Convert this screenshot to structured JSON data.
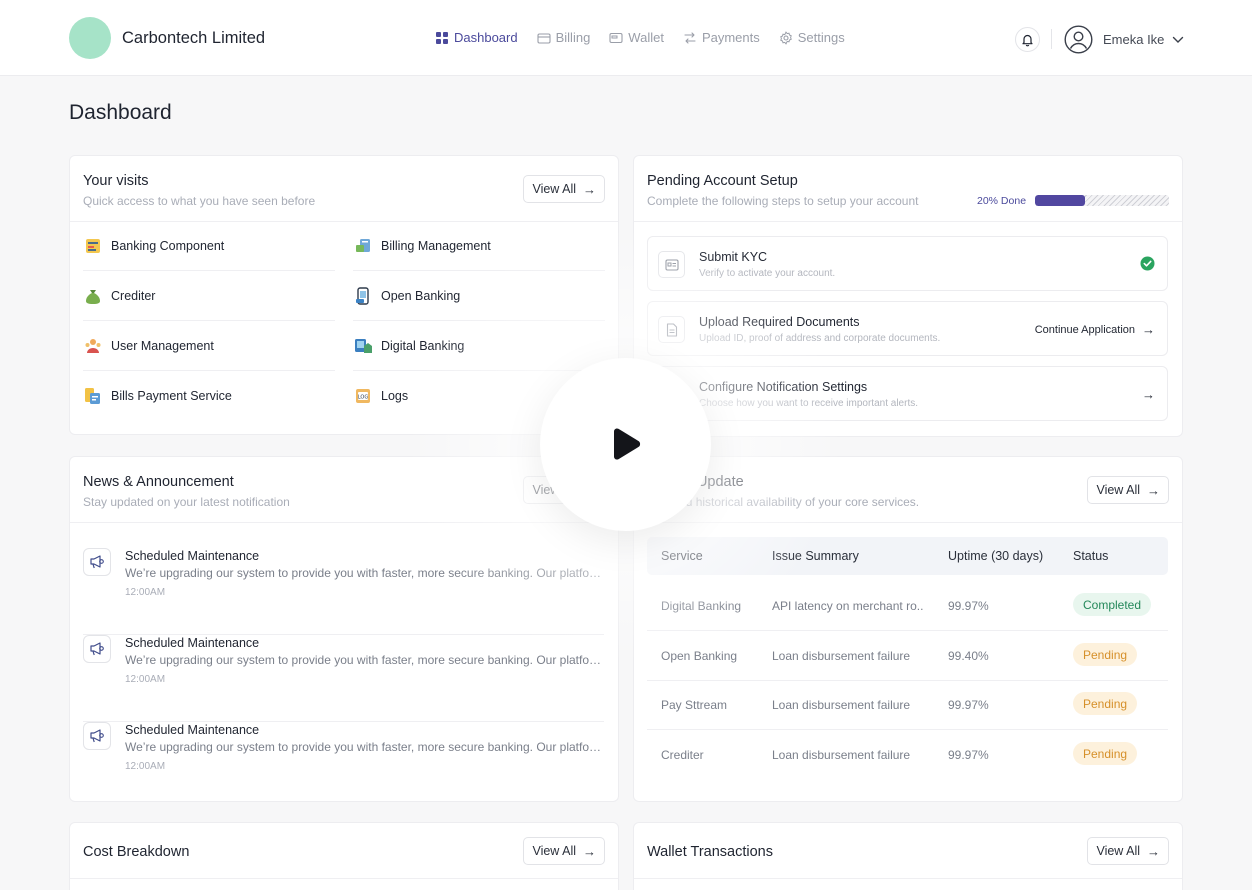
{
  "header": {
    "company": "Carbontech Limited",
    "nav": [
      {
        "label": "Dashboard",
        "icon": "grid-icon",
        "active": true
      },
      {
        "label": "Billing",
        "icon": "card-icon",
        "active": false
      },
      {
        "label": "Wallet",
        "icon": "wallet-icon",
        "active": false
      },
      {
        "label": "Payments",
        "icon": "transfer-icon",
        "active": false
      },
      {
        "label": "Settings",
        "icon": "gear-icon",
        "active": false
      }
    ],
    "user_name": "Emeka Ike"
  },
  "page": {
    "title": "Dashboard"
  },
  "visits": {
    "title": "Your visits",
    "subtitle": "Quick access to what you have seen before",
    "view_all": "View All",
    "items": [
      {
        "label": "Banking Component"
      },
      {
        "label": "Billing Management"
      },
      {
        "label": "Crediter"
      },
      {
        "label": "Open Banking"
      },
      {
        "label": "User Management"
      },
      {
        "label": "Digital Banking"
      },
      {
        "label": "Bills Payment Service"
      },
      {
        "label": "Logs"
      }
    ]
  },
  "setup": {
    "title": "Pending Account Setup",
    "subtitle": "Complete the following steps to setup your account",
    "progress_label": "20% Done",
    "progress_value": 0.37,
    "steps": [
      {
        "title": "Submit KYC",
        "desc": "Verify to activate your account.",
        "action": ""
      },
      {
        "title": "Upload Required Documents",
        "desc": "Upload ID, proof of address and corporate documents.",
        "action": "Continue Application"
      },
      {
        "title": "Configure Notification Settings",
        "desc": "Choose how you want to receive important alerts.",
        "action": ""
      }
    ]
  },
  "news": {
    "title": "News & Announcement",
    "subtitle": "Stay updated on your latest notification",
    "view_all": "View All",
    "items": [
      {
        "title": "Scheduled Maintenance",
        "body": "We’re upgrading our system to provide you with faster, more secure banking. Our platform will be briefly unavailable during the scheduled window.",
        "time": "12:00AM"
      },
      {
        "title": "Scheduled Maintenance",
        "body": "We’re upgrading our system to provide you with faster, more secure banking. Our platform will be briefly unavailable during the scheduled window.",
        "time": "12:00AM"
      },
      {
        "title": "Scheduled Maintenance",
        "body": "We’re upgrading our system to provide you with faster, more secure banking. Our platform will be briefly unavailable during the scheduled window.",
        "time": "12:00AM"
      }
    ]
  },
  "uptime": {
    "title": "Uptime Update",
    "subtitle": "Live and historical availability of your core services.",
    "view_all": "View All",
    "columns": [
      "Service",
      "Issue Summary",
      "Uptime (30 days)",
      "Status"
    ],
    "rows": [
      {
        "service": "Digital Banking",
        "issue": "API latency on merchant ro..",
        "uptime": "99.97%",
        "status": "Completed",
        "kind": "ok"
      },
      {
        "service": "Open Banking",
        "issue": "Loan disbursement failure",
        "uptime": "99.40%",
        "status": "Pending",
        "kind": "pend"
      },
      {
        "service": "Pay Sttream",
        "issue": "Loan disbursement failure",
        "uptime": "99.97%",
        "status": "Pending",
        "kind": "pend"
      },
      {
        "service": "Crediter",
        "issue": "Loan disbursement failure",
        "uptime": "99.97%",
        "status": "Pending",
        "kind": "pend"
      }
    ]
  },
  "cost": {
    "title": "Cost Breakdown",
    "view_all": "View All"
  },
  "wallet_tx": {
    "title": "Wallet Transactions",
    "view_all": "View All"
  },
  "colors": {
    "accent": "#4b4a9c",
    "progress": "#5147a0",
    "success": "#24885a",
    "warning": "#d6902a"
  }
}
